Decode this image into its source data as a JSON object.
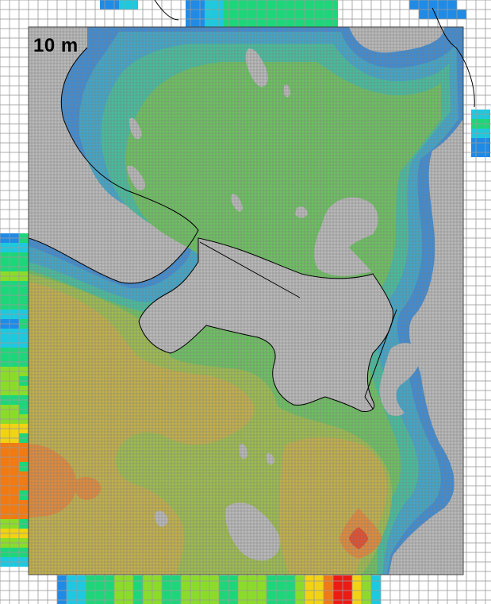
{
  "map": {
    "scale_label": "10 m",
    "colors": {
      "land": "#b9b9b9",
      "coarse_grid_bg": "#ffffff",
      "grid_line": "#9a9a9a",
      "coastline": "#000000",
      "level_1": "#3d8bd3",
      "level_2": "#3fa6c9",
      "level_3": "#45bd9c",
      "level_4": "#6cc160",
      "level_5": "#9dbd4e",
      "level_6": "#c2b04a",
      "level_7": "#e08a3a",
      "level_8": "#e24b2c",
      "coarse_blue": "#1f8be6",
      "coarse_cyan": "#1dc9e0",
      "coarse_green": "#1ed67a",
      "coarse_lime": "#8bdc2a",
      "coarse_yellow": "#f2d313",
      "coarse_orange": "#f07a13",
      "coarse_red": "#ee1a14"
    }
  }
}
